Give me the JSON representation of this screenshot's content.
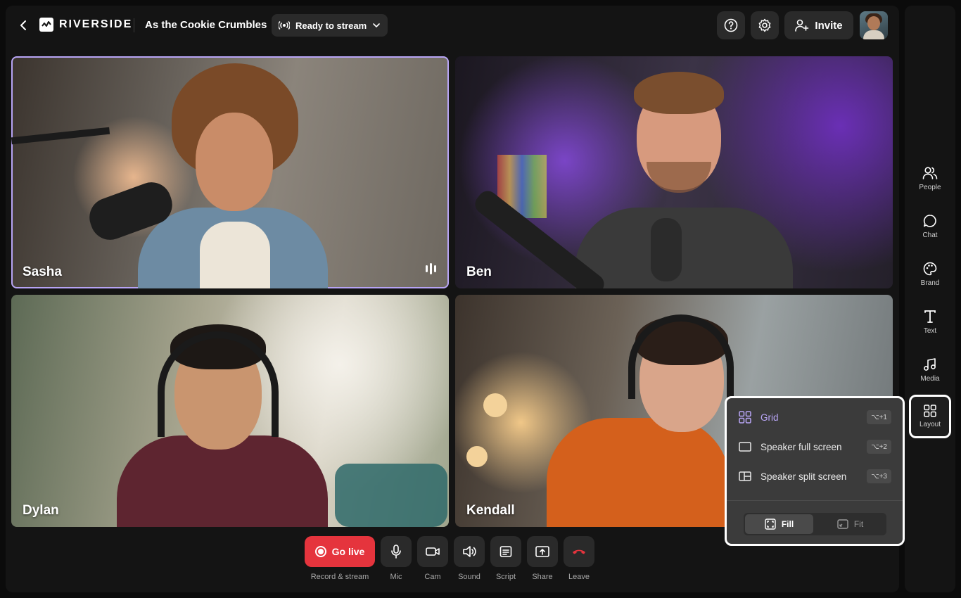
{
  "header": {
    "brand": "RIVERSIDE",
    "session_title": "As the Cookie Crumbles",
    "status": "Ready to stream",
    "invite_label": "Invite"
  },
  "participants": [
    {
      "name": "Sasha",
      "speaking": true
    },
    {
      "name": "Ben",
      "speaking": false
    },
    {
      "name": "Dylan",
      "speaking": false
    },
    {
      "name": "Kendall",
      "speaking": false
    }
  ],
  "controls": {
    "go_live": "Go live",
    "go_live_caption": "Record & stream",
    "mic": "Mic",
    "cam": "Cam",
    "sound": "Sound",
    "script": "Script",
    "share": "Share",
    "leave": "Leave"
  },
  "sidebar": {
    "items": [
      {
        "label": "People",
        "icon": "people-icon"
      },
      {
        "label": "Chat",
        "icon": "chat-icon"
      },
      {
        "label": "Brand",
        "icon": "palette-icon"
      },
      {
        "label": "Text",
        "icon": "text-icon"
      },
      {
        "label": "Media",
        "icon": "music-icon"
      },
      {
        "label": "Layout",
        "icon": "layout-grid-icon",
        "selected": true
      }
    ]
  },
  "layout_menu": {
    "options": [
      {
        "label": "Grid",
        "shortcut": "⌥+1",
        "active": true
      },
      {
        "label": "Speaker full screen",
        "shortcut": "⌥+2",
        "active": false
      },
      {
        "label": "Speaker split screen",
        "shortcut": "⌥+3",
        "active": false
      }
    ],
    "fill_label": "Fill",
    "fit_label": "Fit",
    "selected_mode": "Fill"
  },
  "colors": {
    "accent": "#b9a6f7",
    "live": "#e5343d",
    "leave": "#e5343d"
  }
}
